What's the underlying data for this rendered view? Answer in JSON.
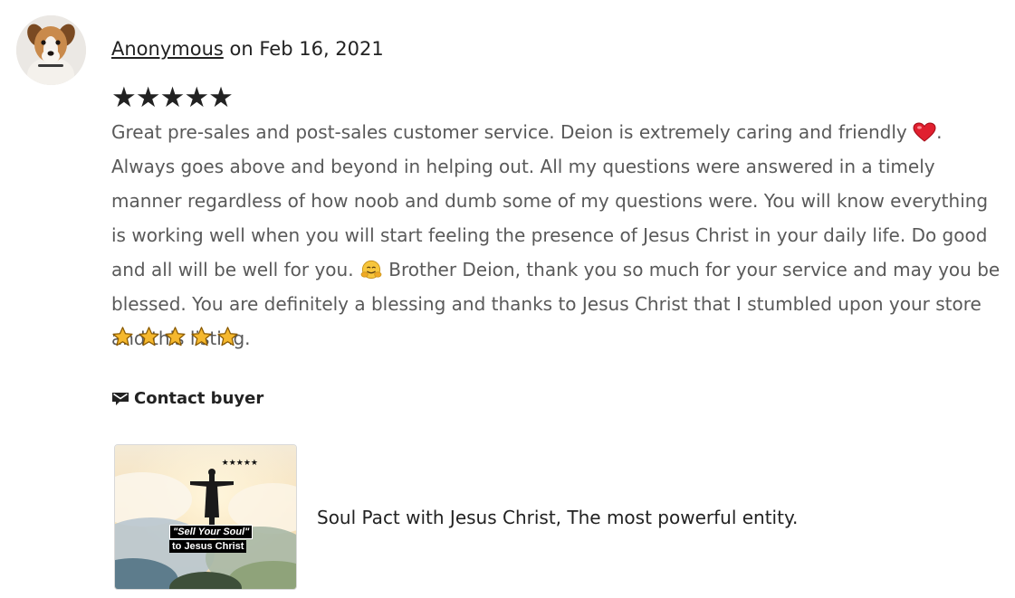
{
  "reviewer": {
    "name": "Anonymous",
    "date_prefix": "on",
    "date": "Feb 16, 2021",
    "avatar_icon": "dog-avatar"
  },
  "rating": {
    "value": 5,
    "max": 5,
    "display": "★★★★★"
  },
  "review": {
    "part1": "Great pre-sales and post-sales customer service. Deion is extremely caring and friendly ",
    "emoji1": "red-heart-emoji",
    "part2": ". Always goes above and beyond in helping out. All my questions were answered in a timely manner regardless of how noob and dumb some of my questions were. You will know everything is working well when you will start feeling the presence of Jesus Christ in your daily life. Do good and all will be well for you. ",
    "emoji2": "hugging-face-emoji",
    "part3": " Brother Deion, thank you so much for your service and may you be blessed. You are definitely a blessing and thanks to Jesus Christ that I stumbled upon your store and this listing.",
    "star_emoji_count": 5
  },
  "contact": {
    "label": "Contact buyer",
    "icon": "envelope-icon"
  },
  "listing": {
    "title": "Soul Pact with Jesus Christ, The most powerful entity.",
    "thumbnail": {
      "stars": "★★★★★",
      "caption_line1": "\"Sell Your Soul\"",
      "caption_line2": "to Jesus Christ"
    }
  },
  "colors": {
    "text_primary": "#222222",
    "text_review": "#595959",
    "heart": "#e0202f",
    "gold_star": "#f5b82e"
  }
}
